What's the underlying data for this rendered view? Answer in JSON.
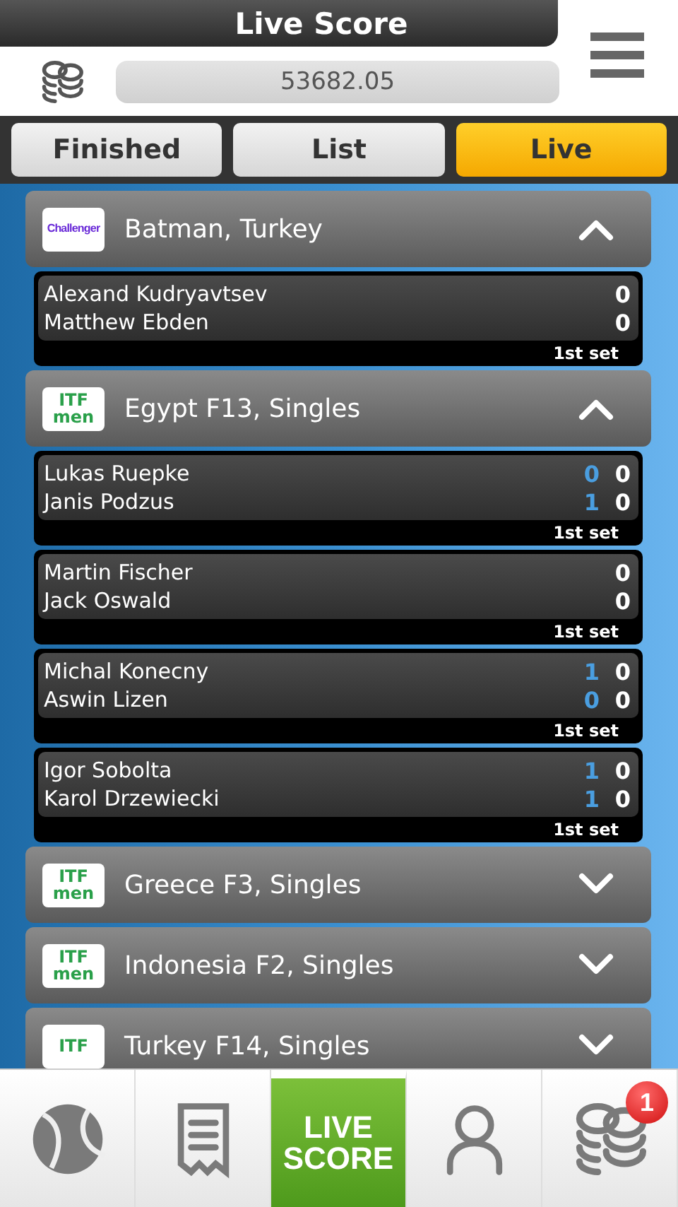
{
  "header": {
    "title": "Live Score",
    "balance": "53682.05"
  },
  "tabs": [
    {
      "label": "Finished",
      "selected": false
    },
    {
      "label": "List",
      "selected": false
    },
    {
      "label": "Live",
      "selected": true
    }
  ],
  "groups": [
    {
      "logo": {
        "kind": "challenger",
        "lines": [
          "Challenger"
        ]
      },
      "name": "Batman, Turkey",
      "expanded": true,
      "matches": [
        {
          "players": [
            {
              "name": "Alexand Kudryavtsev",
              "games": "0"
            },
            {
              "name": "Matthew Ebden",
              "games": "0"
            }
          ],
          "set": "1st set"
        }
      ]
    },
    {
      "logo": {
        "kind": "itf",
        "lines": [
          "ITF",
          "men"
        ]
      },
      "name": "Egypt F13, Singles",
      "expanded": true,
      "matches": [
        {
          "players": [
            {
              "name": "Lukas Ruepke",
              "points": "0",
              "games": "0"
            },
            {
              "name": "Janis Podzus",
              "points": "1",
              "games": "0"
            }
          ],
          "set": "1st set"
        },
        {
          "players": [
            {
              "name": "Martin Fischer",
              "games": "0"
            },
            {
              "name": "Jack Oswald",
              "games": "0"
            }
          ],
          "set": "1st set"
        },
        {
          "players": [
            {
              "name": "Michal Konecny",
              "points": "1",
              "games": "0"
            },
            {
              "name": "Aswin Lizen",
              "points": "0",
              "games": "0"
            }
          ],
          "set": "1st set"
        },
        {
          "players": [
            {
              "name": "Igor Sobolta",
              "points": "1",
              "games": "0"
            },
            {
              "name": "Karol Drzewiecki",
              "points": "1",
              "games": "0"
            }
          ],
          "set": "1st set"
        }
      ]
    },
    {
      "logo": {
        "kind": "itf",
        "lines": [
          "ITF",
          "men"
        ]
      },
      "name": "Greece F3, Singles",
      "expanded": false
    },
    {
      "logo": {
        "kind": "itf",
        "lines": [
          "ITF",
          "men"
        ]
      },
      "name": "Indonesia F2, Singles",
      "expanded": false
    },
    {
      "logo": {
        "kind": "itf",
        "lines": [
          "ITF"
        ]
      },
      "name": "Turkey F14, Singles",
      "expanded": false
    }
  ],
  "nav": [
    {
      "kind": "ball",
      "selected": false
    },
    {
      "kind": "receipt",
      "selected": false
    },
    {
      "kind": "live",
      "lines": [
        "LIVE",
        "SCORE"
      ],
      "selected": true
    },
    {
      "kind": "person",
      "selected": false
    },
    {
      "kind": "coins",
      "badge": "1",
      "selected": false
    }
  ]
}
